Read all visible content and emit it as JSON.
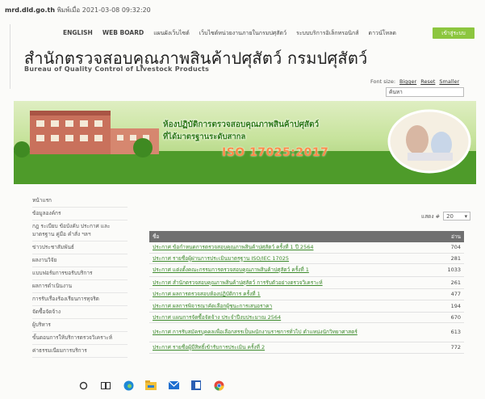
{
  "url": {
    "host": "mrd.dld.go.th",
    "rest": " พิมพ์เมื่อ 2021-03-08 09:32:20"
  },
  "topnav": [
    "ENGLISH",
    "WEB BOARD",
    "แผนผังเว็บไซต์",
    "เว็บไซต์หน่วยงานภายในกรมปศุสัตว์",
    "ระบบบริการอิเล็กทรอนิกส์",
    "ดาวน์โหลด"
  ],
  "login_label": "เข้าสู่ระบบ",
  "org": {
    "thai": "สำนักตรวจสอบคุณภาพสินค้าปศุสัตว์ กรมปศุสัตว์",
    "english": "Bureau of Quality Control of Livestock Products"
  },
  "font_size": {
    "label": "Font size:",
    "options": [
      "Bigger",
      "Reset",
      "Smaller"
    ]
  },
  "search": {
    "value": "ค้นหา"
  },
  "banner": {
    "line1": "ห้องปฏิบัติการตรวจสอบคุณภาพสินค้าปศุสัตว์",
    "line2": "ที่ได้มาตรฐานระดับสากล",
    "iso": "ISO 17025:2017"
  },
  "sidebar": [
    "หน้าแรก",
    "ข้อมูลองค์กร",
    "กฎ ระเบียบ ข้อบังคับ ประกาศ และมาตรฐาน คู่มือ คำสั่ง ฯลฯ",
    "ข่าวประชาสัมพันธ์",
    "ผลงานวิจัย",
    "แบบฟอร์มการขอรับบริการ",
    "ผลการดำเนินงาน",
    "การรับเรื่องร้องเรียนการทุจริต",
    "จัดซื้อจัดจ้าง",
    "ผู้บริหาร",
    "ขั้นตอนการให้บริการตรวจวิเคราะห์",
    "ค่าธรรมเนียมการบริการ"
  ],
  "per_page": {
    "label": "แสดง #",
    "value": "20"
  },
  "table": {
    "headers": [
      "ชื่อ",
      "อ่าน"
    ],
    "rows": [
      {
        "title": "ประกาศ ข้อกำหนดการตรวจสอบคุณภาพสินค้าปศุสัตว์ ครั้งที่ 1 ปี 2564",
        "hits": "704"
      },
      {
        "title": "ประกาศ รายชื่อผู้ผ่านการประเมินมาตรฐาน ISO/IEC 17025",
        "hits": "281"
      },
      {
        "title": "ประกาศ แต่งตั้งคณะกรรมการตรวจสอบคุณภาพสินค้าปศุสัตว์ ครั้งที่ 1",
        "hits": "1033"
      },
      {
        "title": "ประกาศ สำนักตรวจสอบคุณภาพสินค้าปศุสัตว์ การรับตัวอย่างตรวจวิเคราะห์",
        "hits": "261"
      },
      {
        "title": "ประกาศ ผลการตรวจสอบห้องปฏิบัติการ ครั้งที่ 1",
        "hits": "477"
      },
      {
        "title": "ประกาศ ผลการพิจารณาคัดเลือกผู้ชนะการเสนอราคา",
        "hits": "194"
      },
      {
        "title": "ประกาศ แผนการจัดซื้อจัดจ้าง ประจำปีงบประมาณ 2564",
        "hits": "670"
      },
      {
        "title": "ประกาศ การรับสมัครบุคคลเพื่อเลือกสรรเป็นพนักงานราชการทั่วไป ตำแหน่งนักวิทยาศาสตร์",
        "hits": "613"
      },
      {
        "title": "ประกาศ รายชื่อผู้มีสิทธิ์เข้ารับการประเมิน ครั้งที่ 2",
        "hits": "772"
      }
    ]
  },
  "colors": {
    "accent_green": "#8cc63f",
    "link_green": "#3d8a2c",
    "table_header": "#707070"
  },
  "taskbar_icons": [
    "search-icon",
    "task-view-icon",
    "edge-icon",
    "file-explorer-icon",
    "mail-icon",
    "word-icon",
    "chrome-icon"
  ]
}
